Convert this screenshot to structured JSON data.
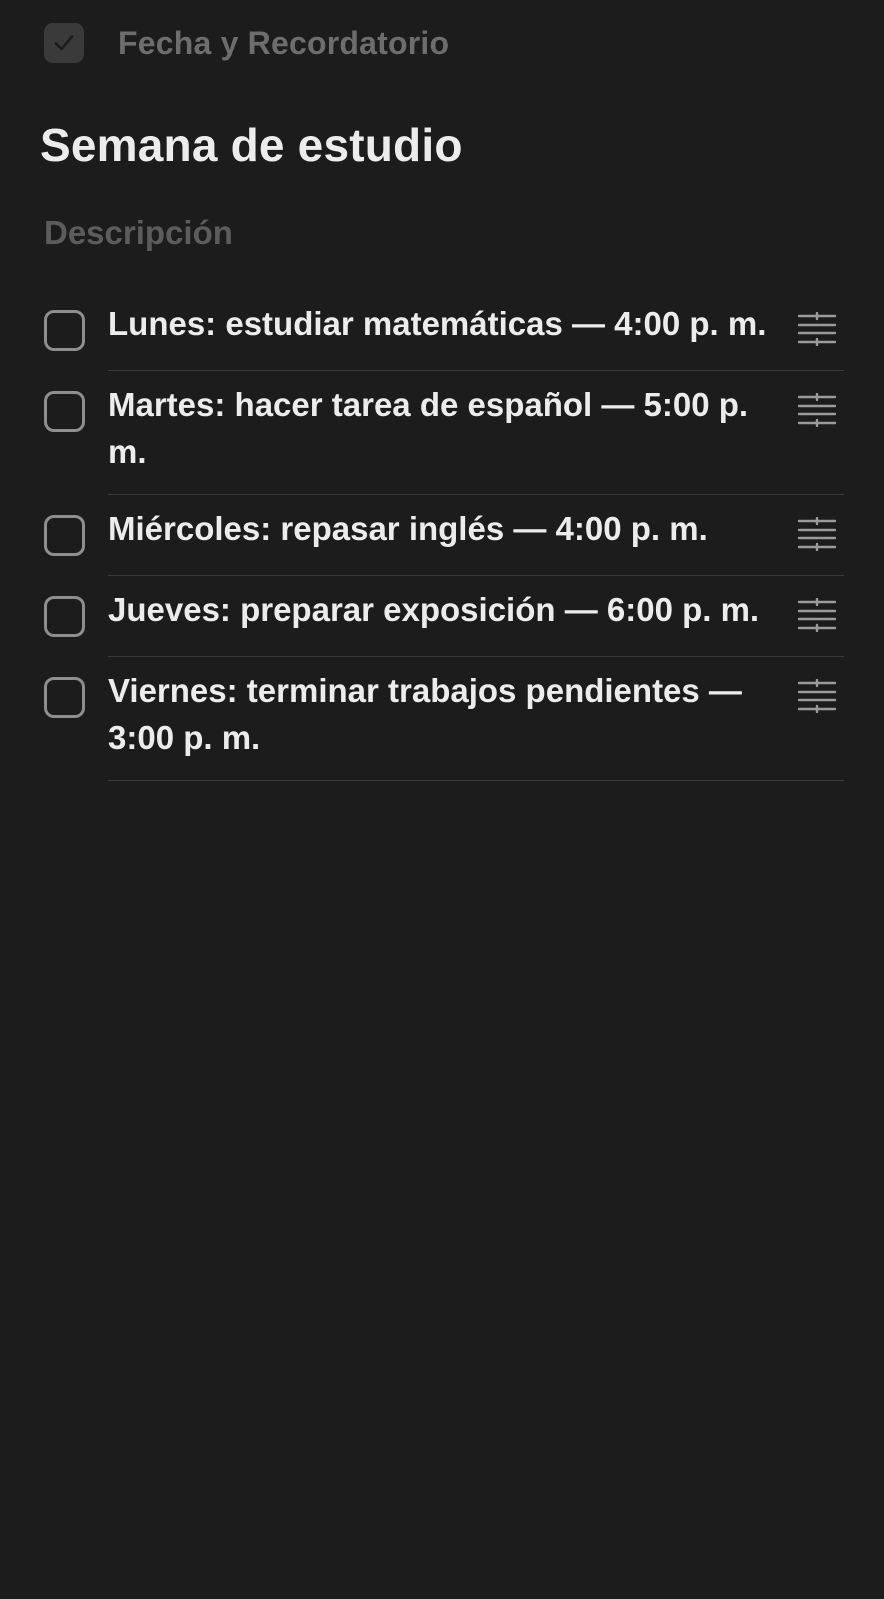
{
  "header": {
    "toggle_label": "Fecha y Recordatorio",
    "toggle_checked": true
  },
  "note": {
    "title": "Semana de estudio",
    "description_placeholder": "Descripción"
  },
  "checklist": {
    "items": [
      {
        "text": "Lunes: estudiar matemáticas — 4:00 p. m.",
        "checked": false
      },
      {
        "text": "Martes: hacer tarea de español — 5:00 p. m.",
        "checked": false
      },
      {
        "text": "Miércoles: repasar inglés — 4:00 p. m.",
        "checked": false
      },
      {
        "text": "Jueves: preparar exposición — 6:00 p. m.",
        "checked": false
      },
      {
        "text": "Viernes: terminar trabajos pendientes — 3:00 p. m.",
        "checked": false
      }
    ]
  },
  "icons": {
    "toggle": "checkbox-checked-icon",
    "item_checkbox": "checkbox-empty-icon",
    "drag_handle": "drag-handle-icon"
  },
  "colors": {
    "background": "#1c1c1c",
    "text_primary": "#ececec",
    "text_muted": "#6d6d6d",
    "divider": "#3a3a3a"
  }
}
